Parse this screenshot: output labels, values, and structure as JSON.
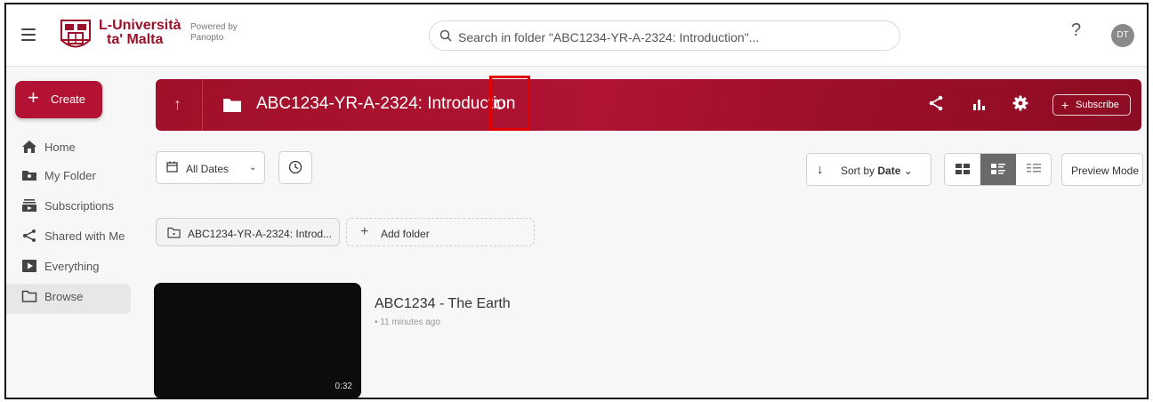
{
  "header": {
    "logo_line1": "L-Università",
    "logo_line2": "ta' Malta",
    "powered_line1": "Powered by",
    "powered_line2": "Panopto",
    "search_placeholder": "Search in folder \"ABC1234-YR-A-2324: Introduction\"...",
    "help_label": "?",
    "avatar_initials": "DT"
  },
  "sidebar": {
    "create_label": "Create",
    "items": [
      {
        "label": "Home",
        "icon": "home-icon"
      },
      {
        "label": "My Folder",
        "icon": "my-folder-icon"
      },
      {
        "label": "Subscriptions",
        "icon": "subscriptions-icon"
      },
      {
        "label": "Shared with Me",
        "icon": "share-icon"
      },
      {
        "label": "Everything",
        "icon": "play-icon"
      },
      {
        "label": "Browse",
        "icon": "folder-icon"
      }
    ],
    "active_item": "Browse"
  },
  "banner": {
    "folder_title": "ABC1234-YR-A-2324: Introduction",
    "subscribe_label": "Subscribe",
    "background_color": "#a01029"
  },
  "filters": {
    "dates_label": "All Dates",
    "sort_prefix": "Sort by",
    "sort_value": "Date",
    "preview_label": "Preview Mode",
    "active_view": "detailed-list"
  },
  "folders": {
    "current_chip": "ABC1234-YR-A-2324: Introd...",
    "add_label": "Add folder"
  },
  "sessions": [
    {
      "title": "ABC1234 - The Earth",
      "meta": "• 11 minutes ago",
      "duration": "0:32"
    }
  ]
}
